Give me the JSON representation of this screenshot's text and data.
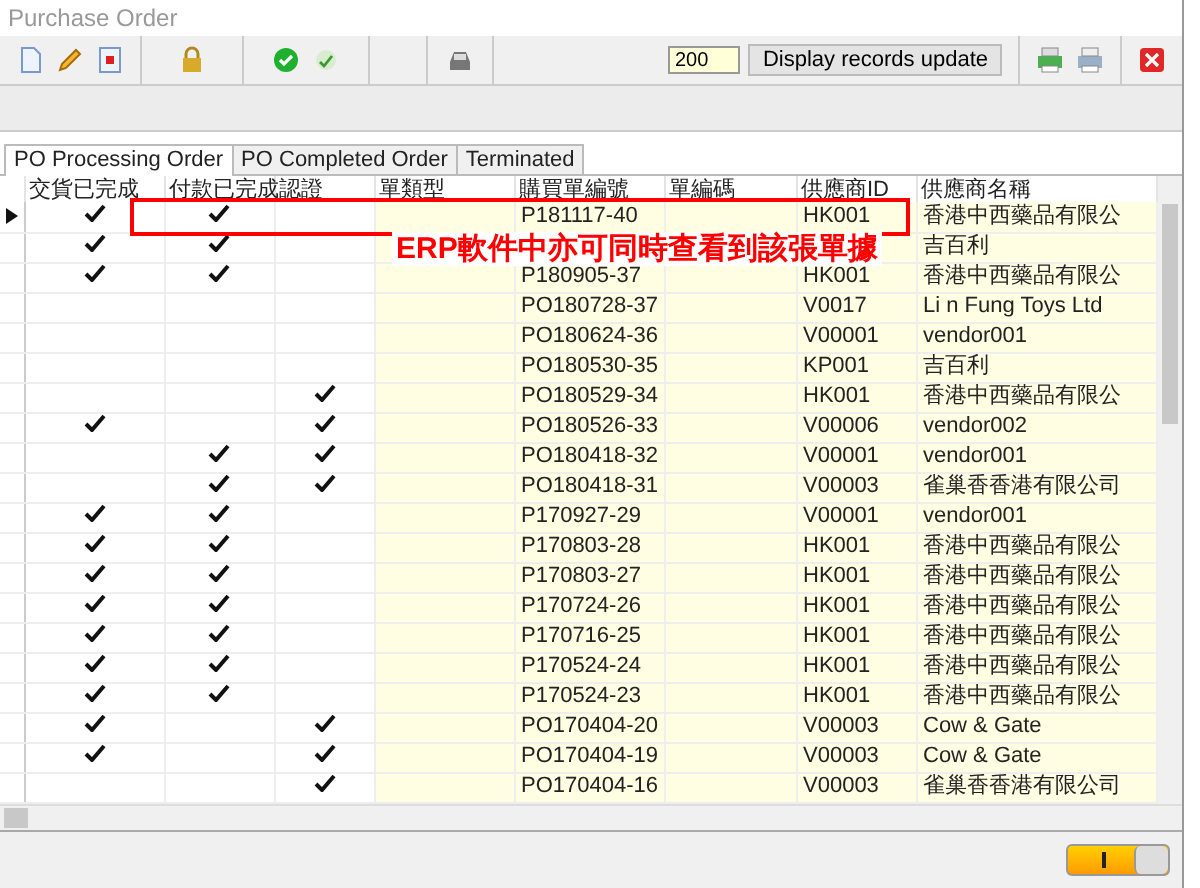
{
  "window": {
    "title": "Purchase Order"
  },
  "toolbar": {
    "record_count": "200",
    "update_button": "Display records update"
  },
  "tabs": [
    {
      "label": "PO Processing Order",
      "selected": true
    },
    {
      "label": "PO Completed Order",
      "selected": false
    },
    {
      "label": "Terminated",
      "selected": false
    }
  ],
  "table": {
    "columns": [
      "交貨已完成",
      "付款已完成",
      "認證",
      "單類型",
      "購買單編號",
      "單編碼",
      "供應商ID",
      "供應商名稱"
    ],
    "rows": [
      {
        "selected": true,
        "delivered": true,
        "paid": true,
        "certified": false,
        "po_number": "P181117-40",
        "vendor_id": "HK001",
        "vendor_name": "香港中西藥品有限公"
      },
      {
        "selected": false,
        "delivered": true,
        "paid": true,
        "certified": false,
        "vendor_name": "吉百利"
      },
      {
        "selected": false,
        "delivered": true,
        "paid": true,
        "certified": false,
        "po_number": "P180905-37",
        "vendor_id": "HK001",
        "vendor_name": "香港中西藥品有限公"
      },
      {
        "selected": false,
        "delivered": false,
        "paid": false,
        "certified": false,
        "po_number": "PO180728-37",
        "vendor_id": "V0017",
        "vendor_name": "Li n Fung Toys Ltd"
      },
      {
        "selected": false,
        "delivered": false,
        "paid": false,
        "certified": false,
        "po_number": "PO180624-36",
        "vendor_id": "V00001",
        "vendor_name": "vendor001"
      },
      {
        "selected": false,
        "delivered": false,
        "paid": false,
        "certified": false,
        "po_number": "PO180530-35",
        "vendor_id": "KP001",
        "vendor_name": "吉百利"
      },
      {
        "selected": false,
        "delivered": false,
        "paid": false,
        "certified": true,
        "po_number": "PO180529-34",
        "vendor_id": "HK001",
        "vendor_name": "香港中西藥品有限公"
      },
      {
        "selected": false,
        "delivered": true,
        "paid": false,
        "certified": true,
        "po_number": "PO180526-33",
        "vendor_id": "V00006",
        "vendor_name": "vendor002"
      },
      {
        "selected": false,
        "delivered": false,
        "paid": true,
        "certified": true,
        "po_number": "PO180418-32",
        "vendor_id": "V00001",
        "vendor_name": "vendor001"
      },
      {
        "selected": false,
        "delivered": false,
        "paid": true,
        "certified": true,
        "po_number": "PO180418-31",
        "vendor_id": "V00003",
        "vendor_name": "雀巢香香港有限公司"
      },
      {
        "selected": false,
        "delivered": true,
        "paid": true,
        "certified": false,
        "po_number": "P170927-29",
        "vendor_id": "V00001",
        "vendor_name": "vendor001"
      },
      {
        "selected": false,
        "delivered": true,
        "paid": true,
        "certified": false,
        "po_number": "P170803-28",
        "vendor_id": "HK001",
        "vendor_name": "香港中西藥品有限公"
      },
      {
        "selected": false,
        "delivered": true,
        "paid": true,
        "certified": false,
        "po_number": "P170803-27",
        "vendor_id": "HK001",
        "vendor_name": "香港中西藥品有限公"
      },
      {
        "selected": false,
        "delivered": true,
        "paid": true,
        "certified": false,
        "po_number": "P170724-26",
        "vendor_id": "HK001",
        "vendor_name": "香港中西藥品有限公"
      },
      {
        "selected": false,
        "delivered": true,
        "paid": true,
        "certified": false,
        "po_number": "P170716-25",
        "vendor_id": "HK001",
        "vendor_name": "香港中西藥品有限公"
      },
      {
        "selected": false,
        "delivered": true,
        "paid": true,
        "certified": false,
        "po_number": "P170524-24",
        "vendor_id": "HK001",
        "vendor_name": "香港中西藥品有限公"
      },
      {
        "selected": false,
        "delivered": true,
        "paid": true,
        "certified": false,
        "po_number": "P170524-23",
        "vendor_id": "HK001",
        "vendor_name": "香港中西藥品有限公"
      },
      {
        "selected": false,
        "delivered": true,
        "paid": false,
        "certified": true,
        "po_number": "PO170404-20",
        "vendor_id": "V00003",
        "vendor_name": "Cow & Gate"
      },
      {
        "selected": false,
        "delivered": true,
        "paid": false,
        "certified": true,
        "po_number": "PO170404-19",
        "vendor_id": "V00003",
        "vendor_name": "Cow & Gate"
      },
      {
        "selected": false,
        "delivered": false,
        "paid": false,
        "certified": true,
        "po_number": "PO170404-16",
        "vendor_id": "V00003",
        "vendor_name": "雀巢香香港有限公司"
      }
    ]
  },
  "annotation": {
    "text": "ERP軟件中亦可同時查看到該張單據"
  },
  "status_bar": {
    "toggle": {
      "on": true
    }
  }
}
